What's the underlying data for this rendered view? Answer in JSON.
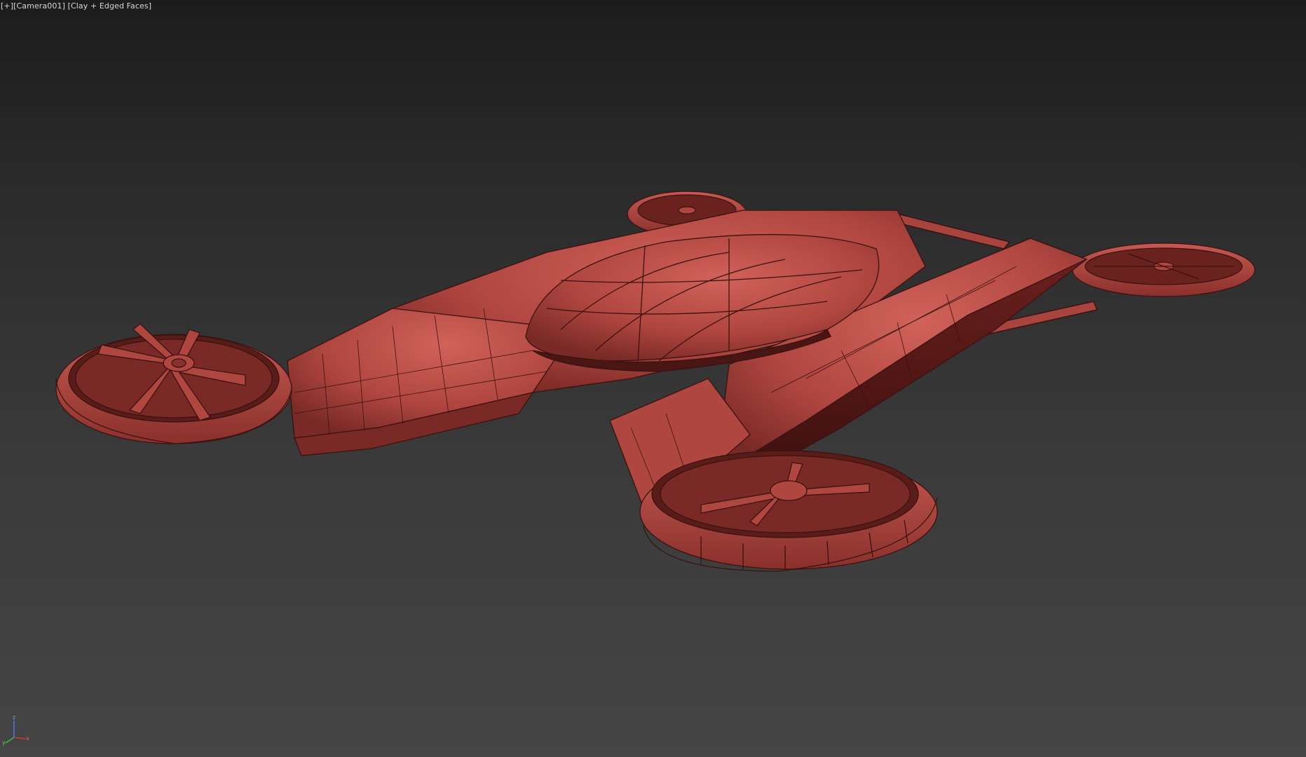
{
  "viewport": {
    "menu_label": "[+]",
    "camera_label": "[Camera001]",
    "shading_label": "[Clay + Edged Faces]"
  },
  "gizmo": {
    "x_label": "x",
    "y_label": "y",
    "z_label": "z",
    "x_color": "#d23a3a",
    "y_color": "#3ac23a",
    "z_color": "#4a7ae0"
  },
  "model": {
    "clay_color": "#b64a44",
    "edge_color": "#3a1210"
  }
}
